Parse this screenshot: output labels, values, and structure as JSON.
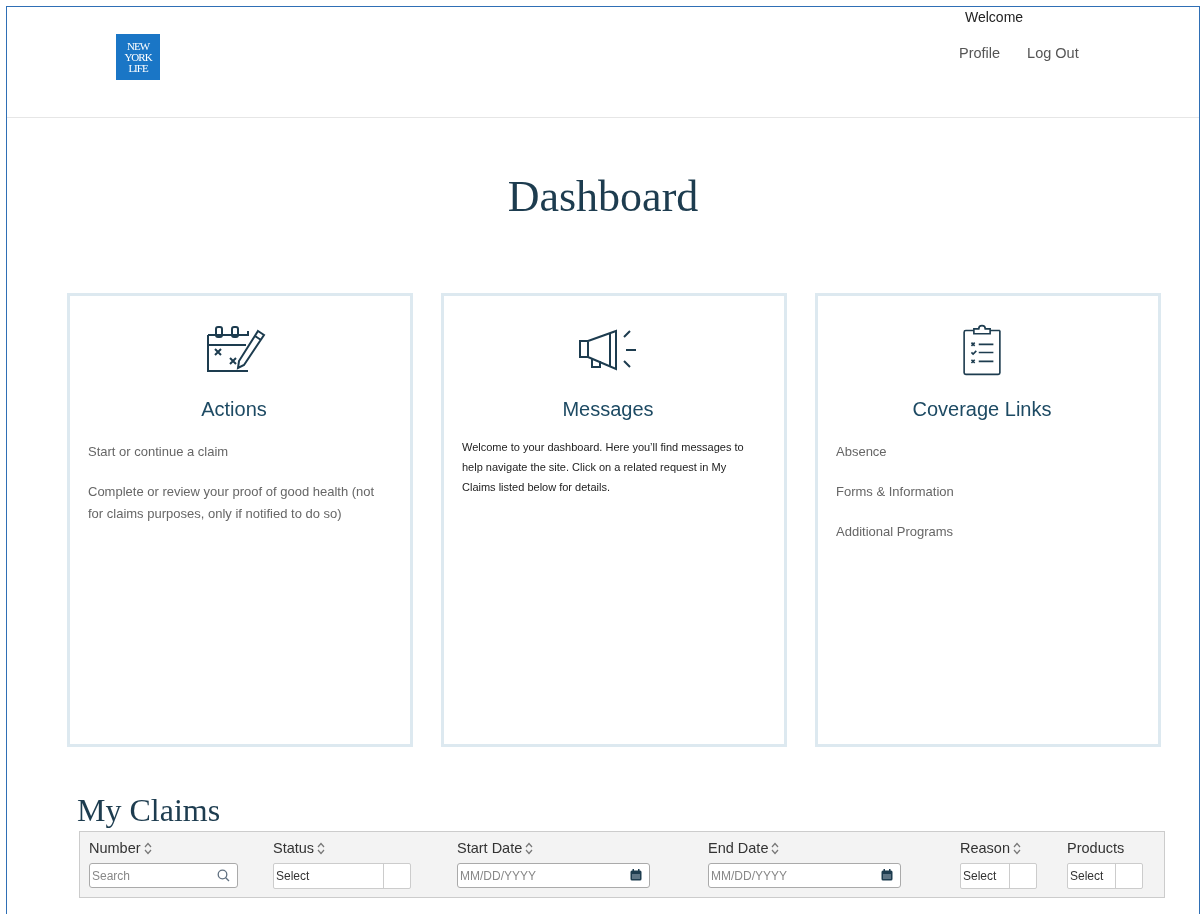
{
  "header": {
    "logo": [
      "NEW",
      "YORK",
      "LIFE"
    ],
    "welcome": "Welcome",
    "nav": [
      "Profile",
      "Log Out"
    ]
  },
  "title": "Dashboard",
  "cards": [
    {
      "kind": "actions",
      "title": "Actions",
      "items": [
        "Start or continue a claim",
        "Complete or review your proof of good health (not for claims purposes, only if notified to do so)"
      ]
    },
    {
      "kind": "messages",
      "title": "Messages",
      "items": [
        "Welcome to your dashboard. Here you’ll find messages to help navigate the site. Click on a related request in My Claims listed below for details."
      ]
    },
    {
      "kind": "coverage",
      "title": "Coverage Links",
      "items": [
        "Absence",
        "Forms & Information",
        "Additional Programs"
      ]
    }
  ],
  "claims": {
    "title": "My Claims",
    "columns": [
      {
        "label": "Number",
        "sortable": true,
        "filter": {
          "kind": "search",
          "placeholder": "Search"
        }
      },
      {
        "label": "Status",
        "sortable": true,
        "filter": {
          "kind": "select",
          "value": "Select"
        }
      },
      {
        "label": "Start Date",
        "sortable": true,
        "filter": {
          "kind": "date",
          "placeholder": "MM/DD/YYYY"
        }
      },
      {
        "label": "End Date",
        "sortable": true,
        "filter": {
          "kind": "date",
          "placeholder": "MM/DD/YYYY"
        }
      },
      {
        "label": "Reason",
        "sortable": true,
        "filter": {
          "kind": "select",
          "value": "Select"
        }
      },
      {
        "label": "Products",
        "sortable": false,
        "filter": {
          "kind": "select",
          "value": "Select"
        }
      }
    ]
  }
}
